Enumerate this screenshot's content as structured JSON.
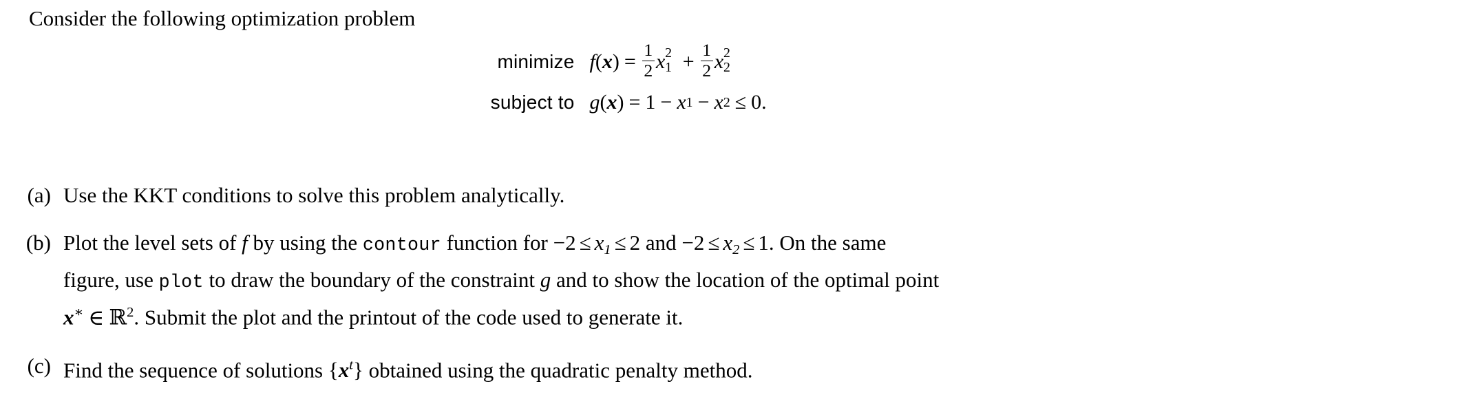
{
  "document": {
    "intro": "Consider the following optimization problem",
    "problem": {
      "objective": {
        "label": "minimize",
        "function_name": "f",
        "variable": "x",
        "equals": "=",
        "term1": {
          "coefficient_numerator": "1",
          "coefficient_denominator": "2",
          "base": "x",
          "subscript": "1",
          "exponent": "2"
        },
        "plus": "+",
        "term2": {
          "coefficient_numerator": "1",
          "coefficient_denominator": "2",
          "base": "x",
          "subscript": "2",
          "exponent": "2"
        }
      },
      "constraint": {
        "label": "subject to",
        "function_name": "g",
        "variable": "x",
        "equals": "=",
        "constant": "1",
        "minus1": "−",
        "var1": "x",
        "var1_sub": "1",
        "minus2": "−",
        "var2": "x",
        "var2_sub": "2",
        "relation": "≤",
        "rhs": "0",
        "period": "."
      }
    },
    "items": [
      {
        "label": "(a)",
        "lines": [
          [
            {
              "type": "text",
              "value": "Use the KKT conditions to solve this problem analytically."
            }
          ]
        ]
      },
      {
        "label": "(b)",
        "lines": [
          [
            {
              "type": "text",
              "value": "Plot the level sets of "
            },
            {
              "type": "math-italic",
              "value": "f"
            },
            {
              "type": "text",
              "value": " by using the "
            },
            {
              "type": "code",
              "value": "contour"
            },
            {
              "type": "text",
              "value": " function for "
            },
            {
              "type": "math-range",
              "value": "−2 ≤ x₁ ≤ 2"
            },
            {
              "type": "text",
              "value": " and "
            },
            {
              "type": "math-range",
              "value": "−2 ≤ x₂ ≤ 1"
            },
            {
              "type": "text",
              "value": ". On the same"
            }
          ],
          [
            {
              "type": "text",
              "value": "figure, use "
            },
            {
              "type": "code",
              "value": "plot"
            },
            {
              "type": "text",
              "value": " to draw the boundary of the constraint "
            },
            {
              "type": "math-italic",
              "value": "g"
            },
            {
              "type": "text",
              "value": " and to show the location of the optimal point"
            }
          ],
          [
            {
              "type": "math-vector",
              "value": "x* ∈ ℝ²"
            },
            {
              "type": "text",
              "value": ". Submit the plot and the printout of the code used to generate it."
            }
          ]
        ]
      },
      {
        "label": "(c)",
        "lines": [
          [
            {
              "type": "text",
              "value": "Find the sequence of solutions "
            },
            {
              "type": "math-set",
              "value": "{xᵗ}"
            },
            {
              "type": "text",
              "value": " obtained using the quadratic penalty method."
            }
          ]
        ]
      }
    ],
    "symbols": {
      "minus": "−",
      "leq": "≤",
      "in": "∈",
      "blackboard_R": "R",
      "brace_open": "{",
      "brace_close": "}",
      "star": "∗",
      "superscript_t": "t",
      "superscript_2": "2"
    },
    "inline_text": {
      "a_text": "Use the KKT conditions to solve this problem analytically.",
      "b_seg1": "Plot the level sets of",
      "b_f": "f",
      "b_seg2": "by using the",
      "b_code1": "contour",
      "b_seg3": "function for",
      "b_range1_m2": "−2",
      "b_range1_x": "x",
      "b_range1_sub": "1",
      "b_range1_hi": "2",
      "b_seg4": "and",
      "b_range2_m2": "−2",
      "b_range2_x": "x",
      "b_range2_sub": "2",
      "b_range2_hi": "1",
      "b_seg5": ". On the same",
      "b_line2_seg1": "figure, use",
      "b_code2": "plot",
      "b_line2_seg2": "to draw the boundary of the constraint",
      "b_g": "g",
      "b_line2_seg3": "and to show the location of the optimal point",
      "b_line3_x": "x",
      "b_line3_seg1": ". Submit the plot and the printout of the code used to generate it.",
      "c_seg1": "Find the sequence of solutions",
      "c_x": "x",
      "c_seg2": "obtained using the quadratic penalty method."
    },
    "colors": {
      "background": "#ffffff",
      "text": "#000000"
    }
  }
}
